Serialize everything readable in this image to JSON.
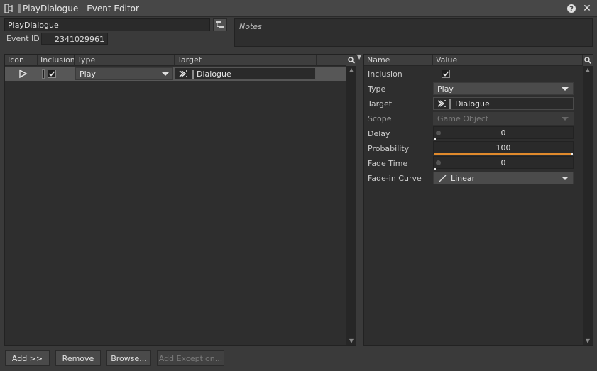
{
  "window": {
    "title": "PlayDialogue - Event Editor",
    "help_glyph": "?",
    "close_glyph": "✕"
  },
  "event": {
    "name": "PlayDialogue",
    "id_label": "Event ID",
    "id_value": "2341029961",
    "notes_placeholder": "Notes"
  },
  "actions_table": {
    "columns": [
      "Icon",
      "Inclusion",
      "Type",
      "Target"
    ],
    "rows": [
      {
        "inclusion": true,
        "type": "Play",
        "target": "Dialogue"
      }
    ]
  },
  "properties": {
    "columns": [
      "Name",
      "Value"
    ],
    "items": [
      {
        "name": "Inclusion",
        "value": true
      },
      {
        "name": "Type",
        "value": "Play"
      },
      {
        "name": "Target",
        "value": "Dialogue"
      },
      {
        "name": "Scope",
        "value": "Game Object",
        "disabled": true
      },
      {
        "name": "Delay",
        "value": "0"
      },
      {
        "name": "Probability",
        "value": "100",
        "fill": 1.0
      },
      {
        "name": "Fade Time",
        "value": "0"
      },
      {
        "name": "Fade-in Curve",
        "value": "Linear"
      }
    ]
  },
  "buttons": {
    "add": "Add >>",
    "remove": "Remove",
    "browse": "Browse...",
    "add_exception": "Add Exception..."
  },
  "colors": {
    "accent_orange": "#e08a2c",
    "selected_row": "#575757"
  }
}
